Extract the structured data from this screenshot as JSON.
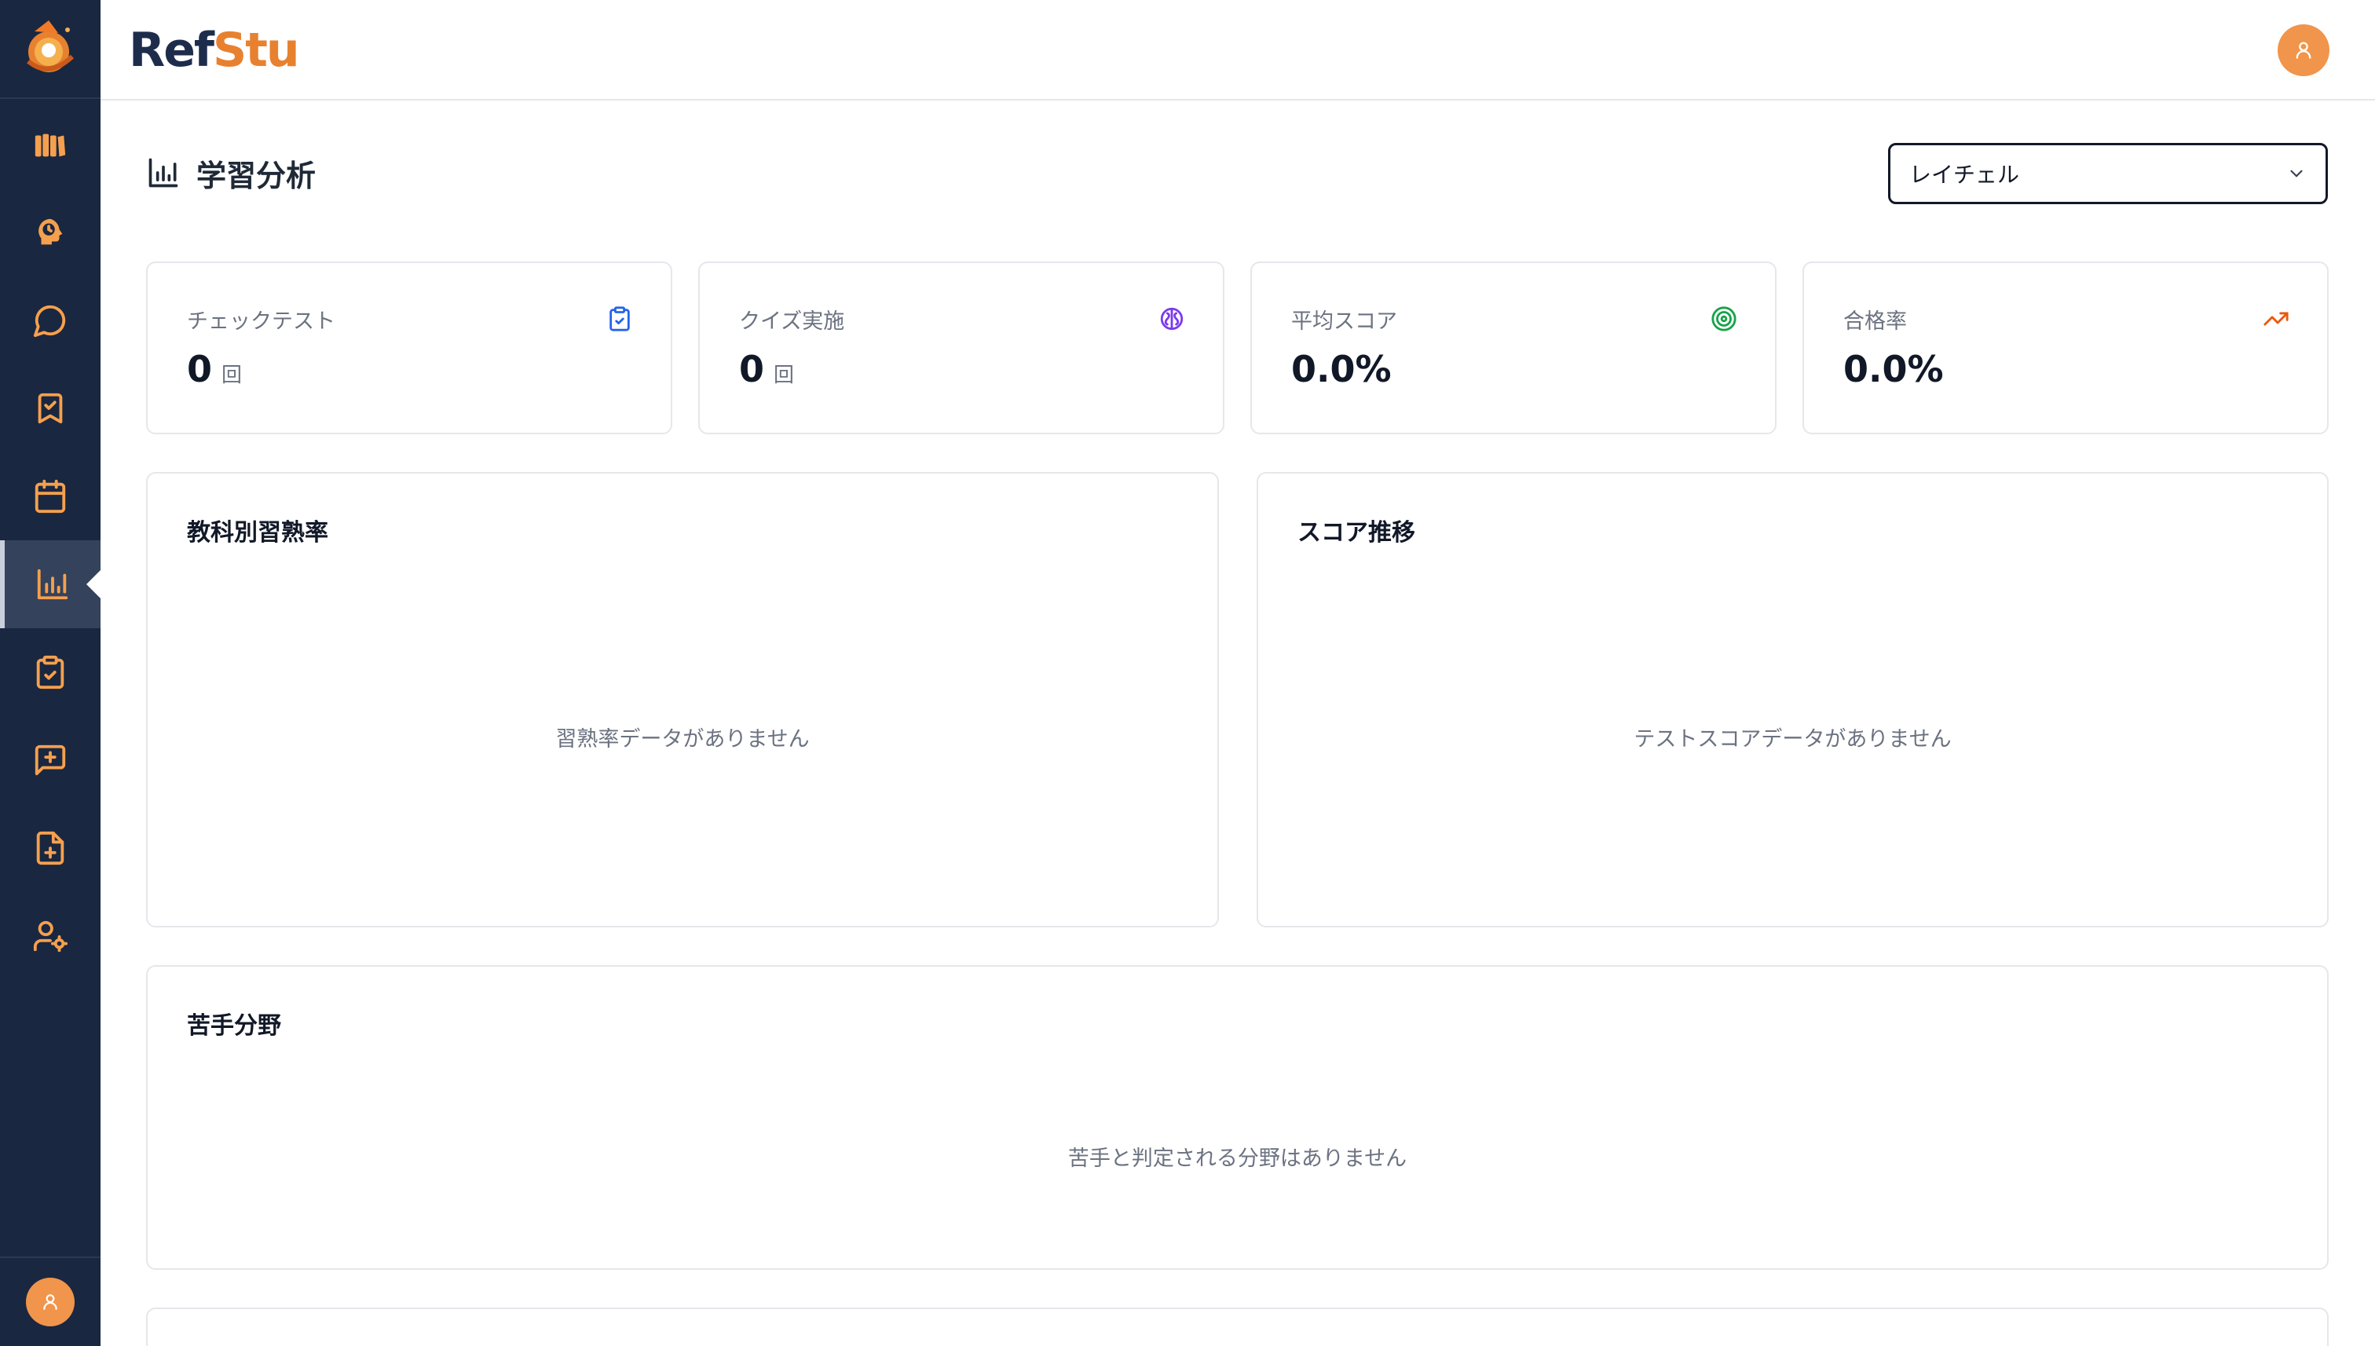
{
  "brand": {
    "part1": "Ref",
    "part2": "Stu"
  },
  "page": {
    "title": "学習分析"
  },
  "student_select": {
    "value": "レイチェル"
  },
  "stats": [
    {
      "label": "チェックテスト",
      "value": "0",
      "unit": "回",
      "icon": "clipboard-check-icon",
      "icon_color": "#2563eb"
    },
    {
      "label": "クイズ実施",
      "value": "0",
      "unit": "回",
      "icon": "brain-icon",
      "icon_color": "#7c3aed"
    },
    {
      "label": "平均スコア",
      "value": "0.0%",
      "unit": "",
      "icon": "target-icon",
      "icon_color": "#16a34a"
    },
    {
      "label": "合格率",
      "value": "0.0%",
      "unit": "",
      "icon": "trending-up-icon",
      "icon_color": "#ea580c"
    }
  ],
  "panels": {
    "mastery": {
      "title": "教科別習熟率",
      "empty": "習熟率データがありません"
    },
    "score_trend": {
      "title": "スコア推移",
      "empty": "テストスコアデータがありません"
    },
    "weak_areas": {
      "title": "苦手分野",
      "empty": "苦手と判定される分野はありません"
    }
  },
  "sidebar": {
    "items": [
      "library-icon",
      "brain-clock-icon",
      "chat-icon",
      "bookmark-check-icon",
      "calendar-icon",
      "bar-chart-icon",
      "clipboard-check-icon",
      "message-plus-icon",
      "file-plus-icon",
      "user-settings-icon"
    ],
    "active_index": 5
  },
  "colors": {
    "sidebar_bg": "#1a2740",
    "accent": "#f0954b",
    "icon_orange": "#f5a04e"
  }
}
